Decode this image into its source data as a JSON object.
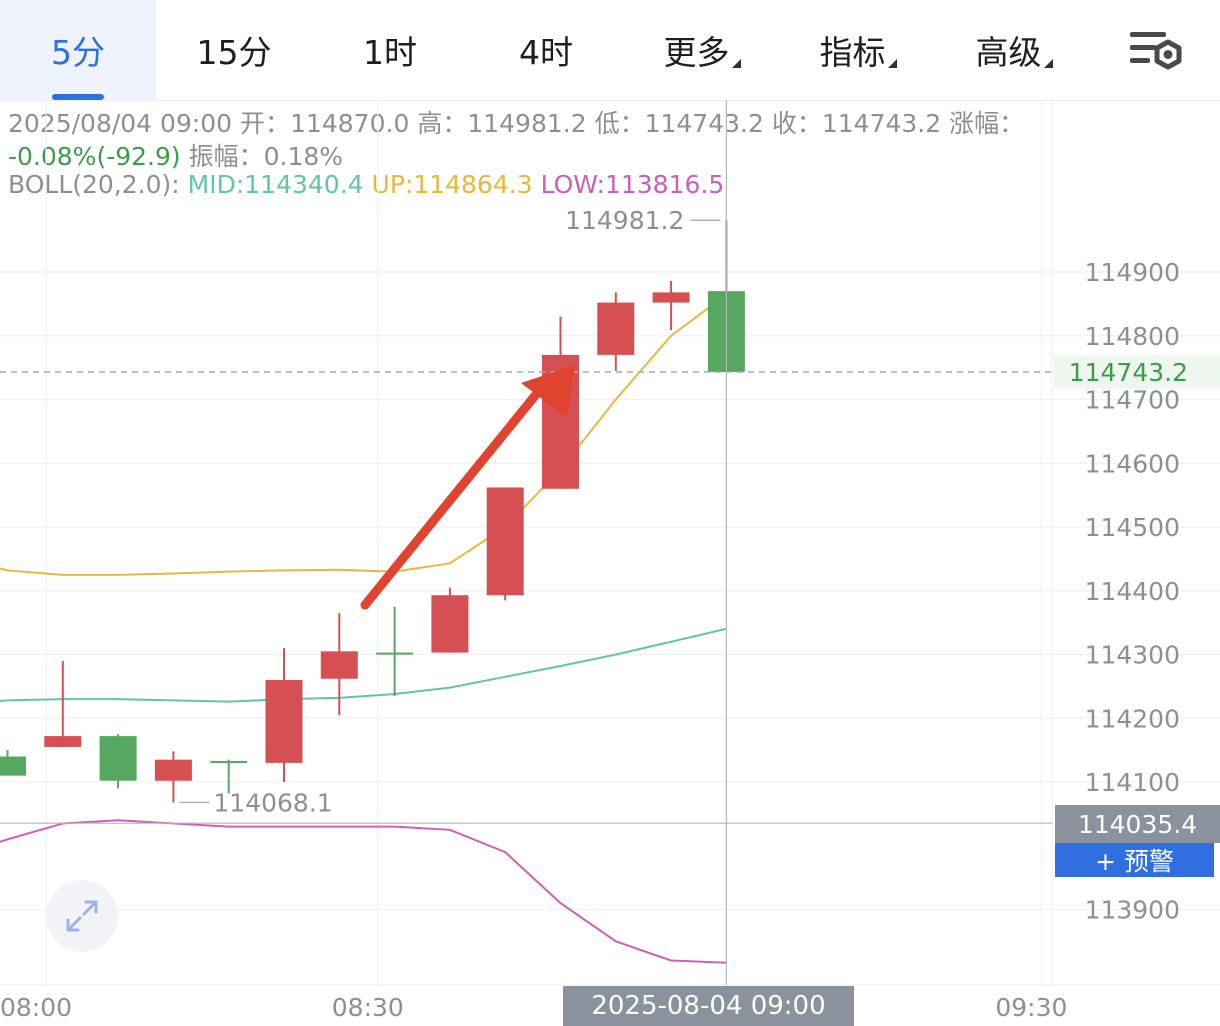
{
  "tabs": [
    {
      "label": "5分",
      "active": true
    },
    {
      "label": "15分"
    },
    {
      "label": "1时"
    },
    {
      "label": "4时"
    },
    {
      "label": "更多",
      "dropdown": true
    },
    {
      "label": "指标",
      "dropdown": true
    },
    {
      "label": "高级",
      "dropdown": true
    }
  ],
  "settings_icon": "chart-settings-icon",
  "info": {
    "datetime": "2025/08/04 09:00",
    "open_label": "开：",
    "open": "114870.0",
    "high_label": "高：",
    "high": "114981.2",
    "low_label": "低：",
    "low": "114743.2",
    "close_label": "收：",
    "close": "114743.2",
    "change_label": "涨幅：",
    "change": "-0.08%(-92.9)",
    "amp_label": "振幅：",
    "amp": "0.18%",
    "boll_label": "BOLL(20,2.0):",
    "mid": "MID:114340.4",
    "up": "UP:114864.3",
    "low_band": "LOW:113816.5"
  },
  "colors": {
    "up_candle": "#d64f52",
    "down_candle": "#56a860",
    "mid_line": "#5fc6a6",
    "upper_line": "#e7b93a",
    "lower_line": "#c961b9",
    "arrow": "#e1442e",
    "accent": "#2f6fe0",
    "change_text": "#3e9b4c"
  },
  "chart_data": {
    "type": "candlestick",
    "ylim": [
      113800,
      115060
    ],
    "yticks": [
      114900,
      114800,
      114700,
      114600,
      114500,
      114400,
      114300,
      114200,
      114100,
      113900
    ],
    "xticks": [
      {
        "label": "08:00",
        "index": 0
      },
      {
        "label": "08:30",
        "index": 6
      },
      {
        "label": "09:30",
        "index": 18
      }
    ],
    "candles": [
      {
        "o": 114140,
        "h": 114150,
        "l": 114110,
        "c": 114110
      },
      {
        "o": 114155,
        "h": 114290,
        "l": 114155,
        "c": 114172
      },
      {
        "o": 114172,
        "h": 114175,
        "l": 114090,
        "c": 114102
      },
      {
        "o": 114102,
        "h": 114148,
        "l": 114068,
        "c": 114135
      },
      {
        "o": 114133,
        "h": 114135,
        "l": 114082,
        "c": 114130
      },
      {
        "o": 114130,
        "h": 114310,
        "l": 114100,
        "c": 114260
      },
      {
        "o": 114262,
        "h": 114365,
        "l": 114205,
        "c": 114305
      },
      {
        "o": 114303,
        "h": 114375,
        "l": 114235,
        "c": 114301
      },
      {
        "o": 114303,
        "h": 114405,
        "l": 114303,
        "c": 114393
      },
      {
        "o": 114393,
        "h": 114562,
        "l": 114385,
        "c": 114562
      },
      {
        "o": 114560,
        "h": 114830,
        "l": 114560,
        "c": 114770
      },
      {
        "o": 114770,
        "h": 114868,
        "l": 114745,
        "c": 114852
      },
      {
        "o": 114852,
        "h": 114886,
        "l": 114809,
        "c": 114868
      },
      {
        "o": 114870,
        "h": 114981.2,
        "l": 114743.2,
        "c": 114743.2
      }
    ],
    "boll_mid": [
      114226,
      114228,
      114230,
      114230,
      114228,
      114226,
      114230,
      114232,
      114238,
      114248,
      114265,
      114282,
      114300,
      114320,
      114340.4
    ],
    "boll_up": [
      114438,
      114432,
      114425,
      114425,
      114427,
      114430,
      114432,
      114433,
      114430,
      114443,
      114500,
      114590,
      114700,
      114800,
      114864.3
    ],
    "boll_low": [
      114002,
      114010,
      114035,
      114040,
      114035,
      114030,
      114030,
      114030,
      114030,
      114025,
      113990,
      113910,
      113850,
      113820,
      113816.5
    ],
    "price_labels": [
      {
        "text": "114981.2",
        "index": 13,
        "value": 114981.2
      },
      {
        "text": "114068.1",
        "index": 3,
        "value": 114068.1
      }
    ],
    "last_price": "114743.2",
    "crosshair_price": "114035.4",
    "alert_label": "+ 预警",
    "crosshair_time": "2025-08-04 09:00",
    "annotation": "red-arrow-pointing-up"
  }
}
